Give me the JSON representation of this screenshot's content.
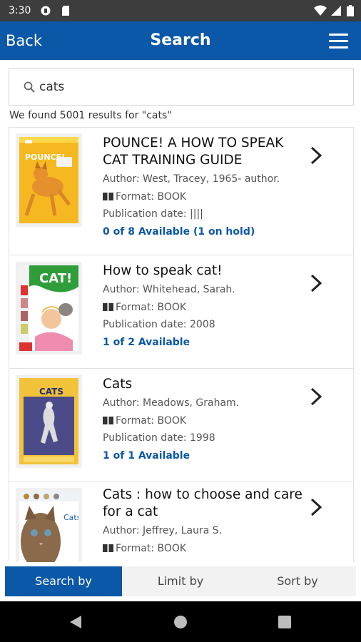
{
  "status_bar": {
    "time": "3:30",
    "icons": [
      "media-icon",
      "storage-icon",
      "wifi-icon",
      "signal-icon",
      "battery-icon"
    ]
  },
  "header": {
    "back_label": "Back",
    "title": "Search",
    "menu_icon": "hamburger-menu-icon"
  },
  "search": {
    "value": "cats",
    "icon": "search-icon"
  },
  "results_summary": "We found 5001 results for \"cats\"",
  "results": [
    {
      "title": "POUNCE! A HOW TO SPEAK CAT TRAINING GUIDE",
      "author": "Author: West, Tracey, 1965- author.",
      "format": "Format: BOOK",
      "publication_date": "Publication date: ||||",
      "availability": "0 of 8 Available (1 on hold)",
      "cover_text": "POUNCE!"
    },
    {
      "title": "How to speak cat!",
      "author": "Author: Whitehead, Sarah.",
      "format": "Format: BOOK",
      "publication_date": "Publication date: 2008",
      "availability": "1 of 2 Available",
      "cover_text": "CAT!"
    },
    {
      "title": "Cats",
      "author": "Author: Meadows, Graham.",
      "format": "Format: BOOK",
      "publication_date": "Publication date: 1998",
      "availability": "1 of 1 Available",
      "cover_text": "CATS"
    },
    {
      "title": "Cats : how to choose and care for a cat",
      "author": "Author: Jeffrey, Laura S.",
      "format": "Format: BOOK",
      "cover_text": "Cats"
    }
  ],
  "tabs": {
    "search_by": "Search by",
    "limit_by": "Limit by",
    "sort_by": "Sort by",
    "active": "search_by"
  },
  "colors": {
    "primary": "#0b57a8",
    "status_bar": "#3d3d3d",
    "nav_bar": "#000000"
  }
}
